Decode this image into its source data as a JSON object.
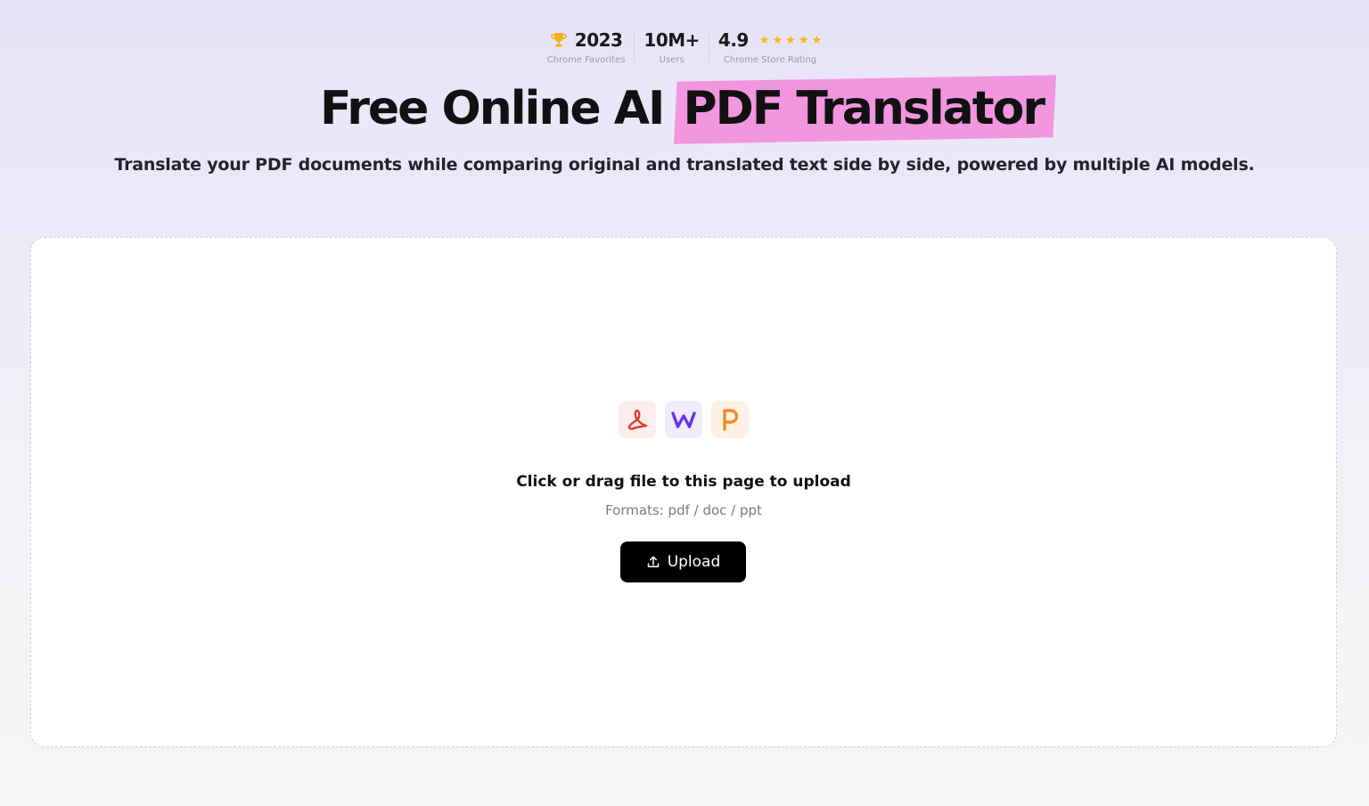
{
  "stats": [
    {
      "icon": "trophy-icon",
      "value": "2023",
      "label": "Chrome Favorites"
    },
    {
      "value": "10M+",
      "label": "Users"
    },
    {
      "value": "4.9",
      "label": "Chrome Store Rating",
      "stars": 5
    }
  ],
  "hero": {
    "title_plain": "Free Online AI",
    "title_highlight": "PDF Translator",
    "subtitle": "Translate your PDF documents while comparing original and translated text side by side, powered by multiple AI models."
  },
  "upload": {
    "format_icons": [
      "pdf-icon",
      "word-icon",
      "powerpoint-icon"
    ],
    "prompt": "Click or drag file to this page to upload",
    "formats": "Formats: pdf / doc / ppt",
    "button_label": "Upload",
    "button_icon": "upload-arrow-icon"
  },
  "colors": {
    "highlight": "#f296df",
    "star": "#f6b21b",
    "button_bg": "#000000",
    "pdf": "#e53935",
    "word": "#6a34e0",
    "ppt": "#f08a24"
  }
}
